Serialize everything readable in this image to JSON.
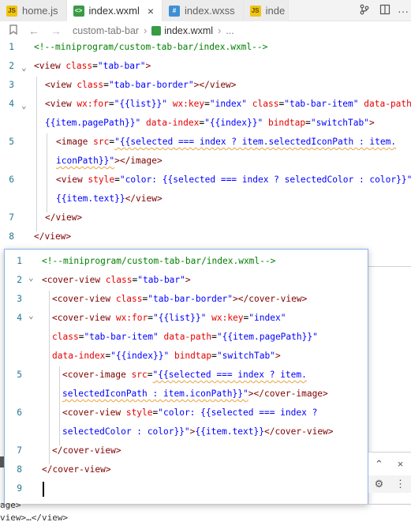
{
  "tabs": [
    {
      "label": "home.js",
      "icon": "js-file-icon",
      "active": false
    },
    {
      "label": "index.wxml",
      "icon": "wxml-file-icon",
      "active": true
    },
    {
      "label": "index.wxss",
      "icon": "wxss-file-icon",
      "active": false
    },
    {
      "label": "inde",
      "icon": "js-file-icon",
      "active": false
    }
  ],
  "tab_close_glyph": "×",
  "breadcrumb": {
    "folder": "custom-tab-bar",
    "file": "index.wxml",
    "more": "..."
  },
  "editor_lines": [
    {
      "n": "1",
      "parts": [
        [
          "c-comment",
          "<!--miniprogram/custom-tab-bar/index.wxml-->"
        ]
      ]
    },
    {
      "n": "2",
      "parts": [
        [
          "c-tag",
          "<view "
        ],
        [
          "c-attr",
          "class"
        ],
        [
          "c-text",
          "="
        ],
        [
          "c-str",
          "\"tab-bar\""
        ],
        [
          "c-tag",
          ">"
        ]
      ]
    },
    {
      "n": "3",
      "parts": [
        [
          "c-tag",
          "<view "
        ],
        [
          "c-attr",
          "class"
        ],
        [
          "c-text",
          "="
        ],
        [
          "c-str",
          "\"tab-bar-border\""
        ],
        [
          "c-tag",
          "></view>"
        ]
      ]
    },
    {
      "n": "4",
      "parts": [
        [
          "c-tag",
          "<view "
        ],
        [
          "c-attr",
          "wx:for"
        ],
        [
          "c-text",
          "="
        ],
        [
          "c-str",
          "\"{{list}}\""
        ],
        [
          "c-text",
          " "
        ],
        [
          "c-attr",
          "wx:key"
        ],
        [
          "c-text",
          "="
        ],
        [
          "c-str",
          "\"index\""
        ],
        [
          "c-text",
          " "
        ],
        [
          "c-attr",
          "class"
        ],
        [
          "c-text",
          "="
        ],
        [
          "c-str",
          "\"tab-bar-item\""
        ],
        [
          "c-text",
          " "
        ],
        [
          "c-attr",
          "data-path"
        ],
        [
          "c-text",
          "="
        ]
      ]
    },
    {
      "n": "",
      "parts": [
        [
          "c-str",
          "{{item.pagePath}}\""
        ],
        [
          "c-text",
          " "
        ],
        [
          "c-attr",
          "data-index"
        ],
        [
          "c-text",
          "="
        ],
        [
          "c-str",
          "\"{{index}}\""
        ],
        [
          "c-text",
          " "
        ],
        [
          "c-attr",
          "bindtap"
        ],
        [
          "c-text",
          "="
        ],
        [
          "c-str",
          "\"switchTab\""
        ],
        [
          "c-tag",
          ">"
        ]
      ]
    },
    {
      "n": "5",
      "parts": [
        [
          "c-tag",
          "<image "
        ],
        [
          "c-attr",
          "src"
        ],
        [
          "c-text",
          "="
        ],
        [
          "c-str",
          "\"{{selected === index ? item.selectedIconPath : item."
        ]
      ]
    },
    {
      "n": "",
      "parts": [
        [
          "c-str",
          "iconPath}}\""
        ],
        [
          "c-tag",
          "></image>"
        ]
      ]
    },
    {
      "n": "6",
      "parts": [
        [
          "c-tag",
          "<view "
        ],
        [
          "c-attr",
          "style"
        ],
        [
          "c-text",
          "="
        ],
        [
          "c-str",
          "\"color: {{selected === index ? selectedColor : color}}\""
        ],
        [
          "c-tag",
          ">"
        ]
      ]
    },
    {
      "n": "",
      "parts": [
        [
          "c-str",
          "{{item.text}}"
        ],
        [
          "c-tag",
          "</view>"
        ]
      ]
    },
    {
      "n": "7",
      "parts": [
        [
          "c-tag",
          "</view>"
        ]
      ]
    },
    {
      "n": "8",
      "parts": [
        [
          "c-tag",
          "</view>"
        ]
      ]
    }
  ],
  "popup_lines": [
    {
      "n": "1",
      "parts": [
        [
          "c-comment",
          "<!--miniprogram/custom-tab-bar/index.wxml-->"
        ]
      ]
    },
    {
      "n": "2",
      "parts": [
        [
          "c-tag",
          "<cover-view "
        ],
        [
          "c-attr",
          "class"
        ],
        [
          "c-text",
          "="
        ],
        [
          "c-str",
          "\"tab-bar\""
        ],
        [
          "c-tag",
          ">"
        ]
      ]
    },
    {
      "n": "3",
      "parts": [
        [
          "c-tag",
          "<cover-view "
        ],
        [
          "c-attr",
          "class"
        ],
        [
          "c-text",
          "="
        ],
        [
          "c-str",
          "\"tab-bar-border\""
        ],
        [
          "c-tag",
          "></cover-view>"
        ]
      ]
    },
    {
      "n": "4",
      "parts": [
        [
          "c-tag",
          "<cover-view "
        ],
        [
          "c-attr",
          "wx:for"
        ],
        [
          "c-text",
          "="
        ],
        [
          "c-str",
          "\"{{list}}\""
        ],
        [
          "c-text",
          " "
        ],
        [
          "c-attr",
          "wx:key"
        ],
        [
          "c-text",
          "="
        ],
        [
          "c-str",
          "\"index\""
        ]
      ]
    },
    {
      "n": "",
      "parts": [
        [
          "c-attr",
          "class"
        ],
        [
          "c-text",
          "="
        ],
        [
          "c-str",
          "\"tab-bar-item\""
        ],
        [
          "c-text",
          " "
        ],
        [
          "c-attr",
          "data-path"
        ],
        [
          "c-text",
          "="
        ],
        [
          "c-str",
          "\"{{item.pagePath}}\""
        ]
      ]
    },
    {
      "n": "",
      "parts": [
        [
          "c-attr",
          "data-index"
        ],
        [
          "c-text",
          "="
        ],
        [
          "c-str",
          "\"{{index}}\""
        ],
        [
          "c-text",
          " "
        ],
        [
          "c-attr",
          "bindtap"
        ],
        [
          "c-text",
          "="
        ],
        [
          "c-str",
          "\"switchTab\""
        ],
        [
          "c-tag",
          ">"
        ]
      ]
    },
    {
      "n": "5",
      "parts": [
        [
          "c-tag",
          "<cover-image "
        ],
        [
          "c-attr",
          "src"
        ],
        [
          "c-text",
          "="
        ],
        [
          "c-str",
          "\"{{selected === index ? item."
        ]
      ]
    },
    {
      "n": "",
      "parts": [
        [
          "c-str",
          "selectedIconPath : item.iconPath}}\""
        ],
        [
          "c-tag",
          "></cover-image>"
        ]
      ]
    },
    {
      "n": "6",
      "parts": [
        [
          "c-tag",
          "<cover-view "
        ],
        [
          "c-attr",
          "style"
        ],
        [
          "c-text",
          "="
        ],
        [
          "c-str",
          "\"color: {{selected === index ?"
        ]
      ]
    },
    {
      "n": "",
      "parts": [
        [
          "c-str",
          "selectedColor : color}}\""
        ],
        [
          "c-tag",
          ">"
        ],
        [
          "c-str",
          "{{item.text}}"
        ],
        [
          "c-tag",
          "</cover-view>"
        ]
      ]
    },
    {
      "n": "7",
      "parts": [
        [
          "c-tag",
          "</cover-view>"
        ]
      ]
    },
    {
      "n": "8",
      "parts": [
        [
          "c-tag",
          "</cover-view>"
        ]
      ]
    },
    {
      "n": "9",
      "parts": []
    }
  ],
  "bottom_fragments": [
    "age>",
    "view>…</view>"
  ]
}
